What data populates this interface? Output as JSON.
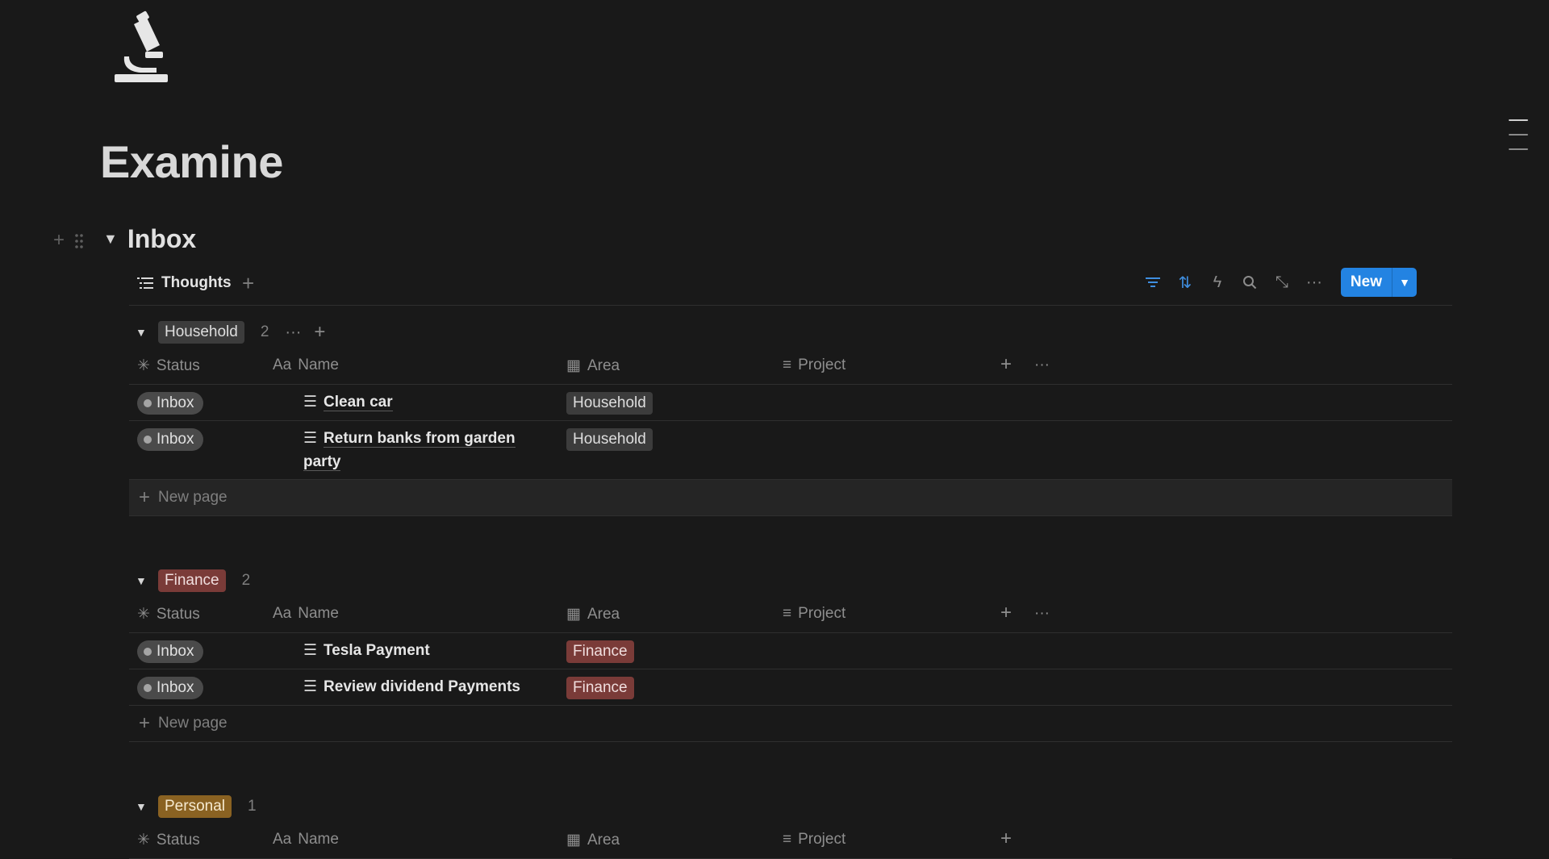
{
  "page": {
    "title": "Examine",
    "icon": "microscope-icon"
  },
  "section": {
    "title": "Inbox"
  },
  "view": {
    "tab_label": "Thoughts",
    "new_button": "New"
  },
  "columns": {
    "status": "Status",
    "name": "Name",
    "name_prefix": "Aa",
    "area": "Area",
    "project": "Project"
  },
  "new_page_label": "New page",
  "groups": [
    {
      "label": "Household",
      "count": "2",
      "color": "#3c3c3c",
      "rows": [
        {
          "status": "Inbox",
          "name": "Clean car",
          "area": "Household"
        },
        {
          "status": "Inbox",
          "name": "Return banks from garden party",
          "area": "Household"
        }
      ]
    },
    {
      "label": "Finance",
      "count": "2",
      "color": "#7a3b38",
      "rows": [
        {
          "status": "Inbox",
          "name": "Tesla Payment",
          "area": "Finance"
        },
        {
          "status": "Inbox",
          "name": "Review dividend Payments",
          "area": "Finance"
        }
      ]
    },
    {
      "label": "Personal",
      "count": "1",
      "color": "#8a6222",
      "rows": []
    }
  ]
}
